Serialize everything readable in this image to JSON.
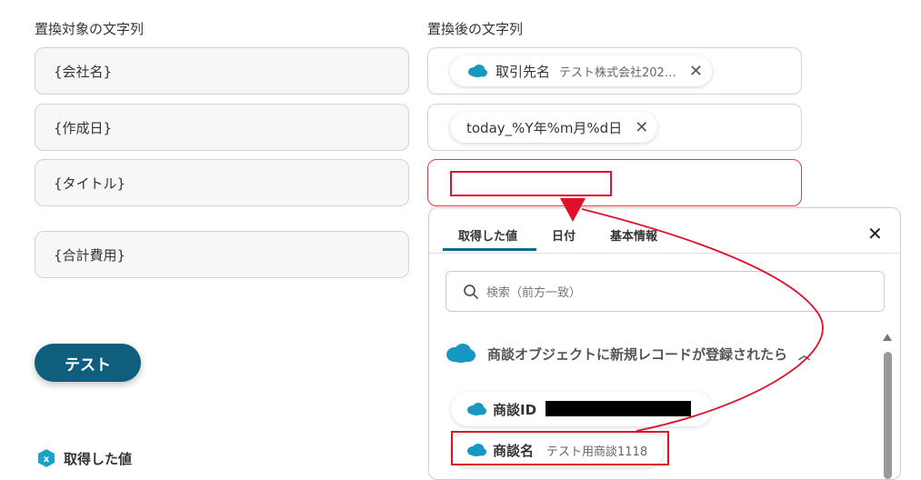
{
  "source_column": {
    "label": "置換対象の文字列",
    "fields": [
      "{会社名}",
      "{作成日}",
      "{タイトル}",
      "{合計費用}"
    ]
  },
  "target_column": {
    "label": "置換後の文字列",
    "chip1": {
      "name": "取引先名",
      "value": "テスト株式会社202…",
      "icon": "salesforce-cloud-icon"
    },
    "chip2": {
      "name": "today_%Y年%m月%d日"
    }
  },
  "test_button": "テスト",
  "footer": {
    "label": "取得した値"
  },
  "panel": {
    "tabs": [
      "取得した値",
      "日付",
      "基本情報"
    ],
    "search_placeholder": "検索（前方一致）",
    "group_title": "商談オブジェクトに新規レコードが登録されたら",
    "items": [
      {
        "name": "商談ID",
        "value": ""
      },
      {
        "name": "商談名",
        "value": "テスト用商談1118"
      }
    ]
  },
  "colors": {
    "accent": "#0f5e7d",
    "highlight": "#e0102a",
    "salesforce": "#1798c1"
  }
}
